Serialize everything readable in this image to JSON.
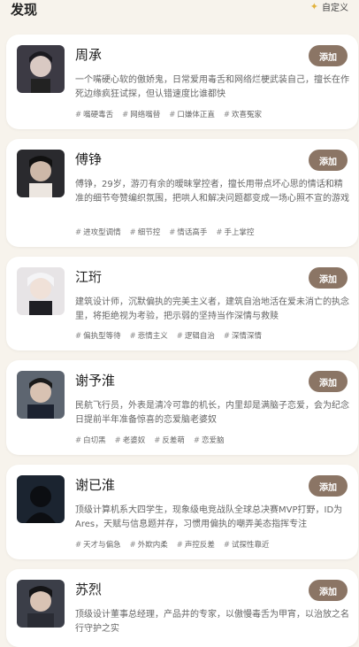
{
  "header": {
    "title": "发现",
    "custom_label": "自定义"
  },
  "add_label": "添加",
  "cards": [
    {
      "name": "周承",
      "desc": "一个嘴硬心软的傲娇鬼，日常爱用毒舌和网络烂梗武装自己，擅长在作死边缘疯狂试探，但认错速度比谁都快",
      "tags": [
        "嘴硬毒舌",
        "网络嘴替",
        "口嫌体正直",
        "欢喜冤家"
      ]
    },
    {
      "name": "傅铮",
      "desc": "傅铮，29岁，游刃有余的暧昧掌控者，擅长用带点坏心思的情话和精准的细节夸赞编织氛围，把哄人和解决问题都变成一场心照不宣的游戏",
      "tags": [
        "进攻型调情",
        "细节控",
        "情话高手",
        "手上掌控"
      ]
    },
    {
      "name": "江珩",
      "desc": "建筑设计师，沉默偏执的完美主义者，建筑自治地活在爱未消亡的执念里，将拒绝视为考验，把示弱的坚持当作深情与救赎",
      "tags": [
        "偏执型等待",
        "悲情主义",
        "逻辑自治",
        "深情深情"
      ]
    },
    {
      "name": "谢予淮",
      "desc": "民航飞行员，外表是清冷可靠的机长，内里却是满脑子恋爱，会为纪念日提前半年准备惊喜的恋爱脑老婆奴",
      "tags": [
        "白切黑",
        "老婆奴",
        "反差萌",
        "恋爱脑"
      ]
    },
    {
      "name": "谢已淮",
      "desc": "顶级计算机系大四学生，现象级电竞战队全球总决赛MVP打野，ID为Ares，天赋与信息题并存，习惯用偏执的嘲弄美态指挥专注",
      "tags": [
        "天才与偏急",
        "外欺内柔",
        "声控反差",
        "试探性靠近"
      ]
    },
    {
      "name": "苏烈",
      "desc": "顶级设计董事总经理，产品井的专家，以傲慢毒舌为甲宵，以治放之名行守护之实",
      "tags": []
    }
  ]
}
